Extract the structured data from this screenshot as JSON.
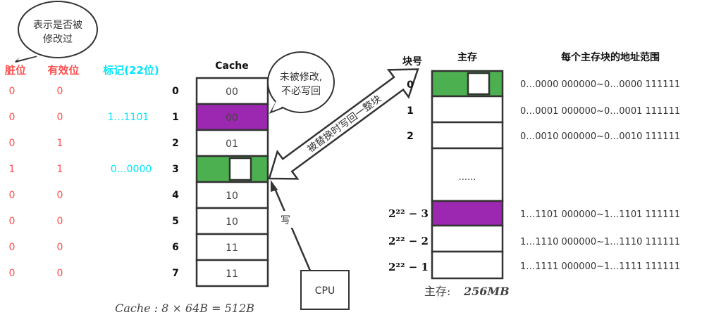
{
  "colors": {
    "dirty": "#ff4d4d",
    "tag": "#00e5ff",
    "green": "#4caf50",
    "purple": "#9c27b0"
  },
  "callout_dirty": {
    "line1": "表示是否被",
    "line2": "修改过"
  },
  "callout_clean": {
    "line1": "未被修改,",
    "line2": "不必写回"
  },
  "headers": {
    "dirty": "脏位",
    "valid": "有效位",
    "tag": "标记(22位)",
    "cache": "Cache",
    "block_no": "块号",
    "memory": "主存",
    "addr_range": "每个主存块的地址范围"
  },
  "cache_rows": [
    {
      "index": "0",
      "dirty": "0",
      "valid": "0",
      "tag": "",
      "content": "00"
    },
    {
      "index": "1",
      "dirty": "0",
      "valid": "0",
      "tag": "1…1101",
      "content": "00"
    },
    {
      "index": "2",
      "dirty": "0",
      "valid": "1",
      "tag": "",
      "content": "01"
    },
    {
      "index": "3",
      "dirty": "1",
      "valid": "1",
      "tag": "0…0000",
      "content": ""
    },
    {
      "index": "4",
      "dirty": "0",
      "valid": "0",
      "tag": "",
      "content": "10"
    },
    {
      "index": "5",
      "dirty": "0",
      "valid": "0",
      "tag": "",
      "content": "10"
    },
    {
      "index": "6",
      "dirty": "0",
      "valid": "0",
      "tag": "",
      "content": "11"
    },
    {
      "index": "7",
      "dirty": "0",
      "valid": "0",
      "tag": "",
      "content": "11"
    }
  ],
  "memory_rows": [
    {
      "block": "0",
      "range": "0…0000 000000~0…0000 111111"
    },
    {
      "block": "1",
      "range": "0…0001 000000~0…0001 111111"
    },
    {
      "block": "2",
      "range": "0…0010 000000~0…0010 111111"
    },
    {
      "block": "",
      "range": "",
      "content": "......"
    },
    {
      "block": "2²² − 3",
      "range": "1…1101 000000~1…1101 111111"
    },
    {
      "block": "2²² − 2",
      "range": "1…1110 000000~1…1110 111111"
    },
    {
      "block": "2²² − 1",
      "range": "1…1111 000000~1…1111 111111"
    }
  ],
  "arrows": {
    "writeback": "被替换时写回一整块",
    "write": "写"
  },
  "cpu": "CPU",
  "captions": {
    "cache": "Cache : 8 × 64B = 512B",
    "memory_label": "主存:",
    "memory_size": "256MB"
  }
}
